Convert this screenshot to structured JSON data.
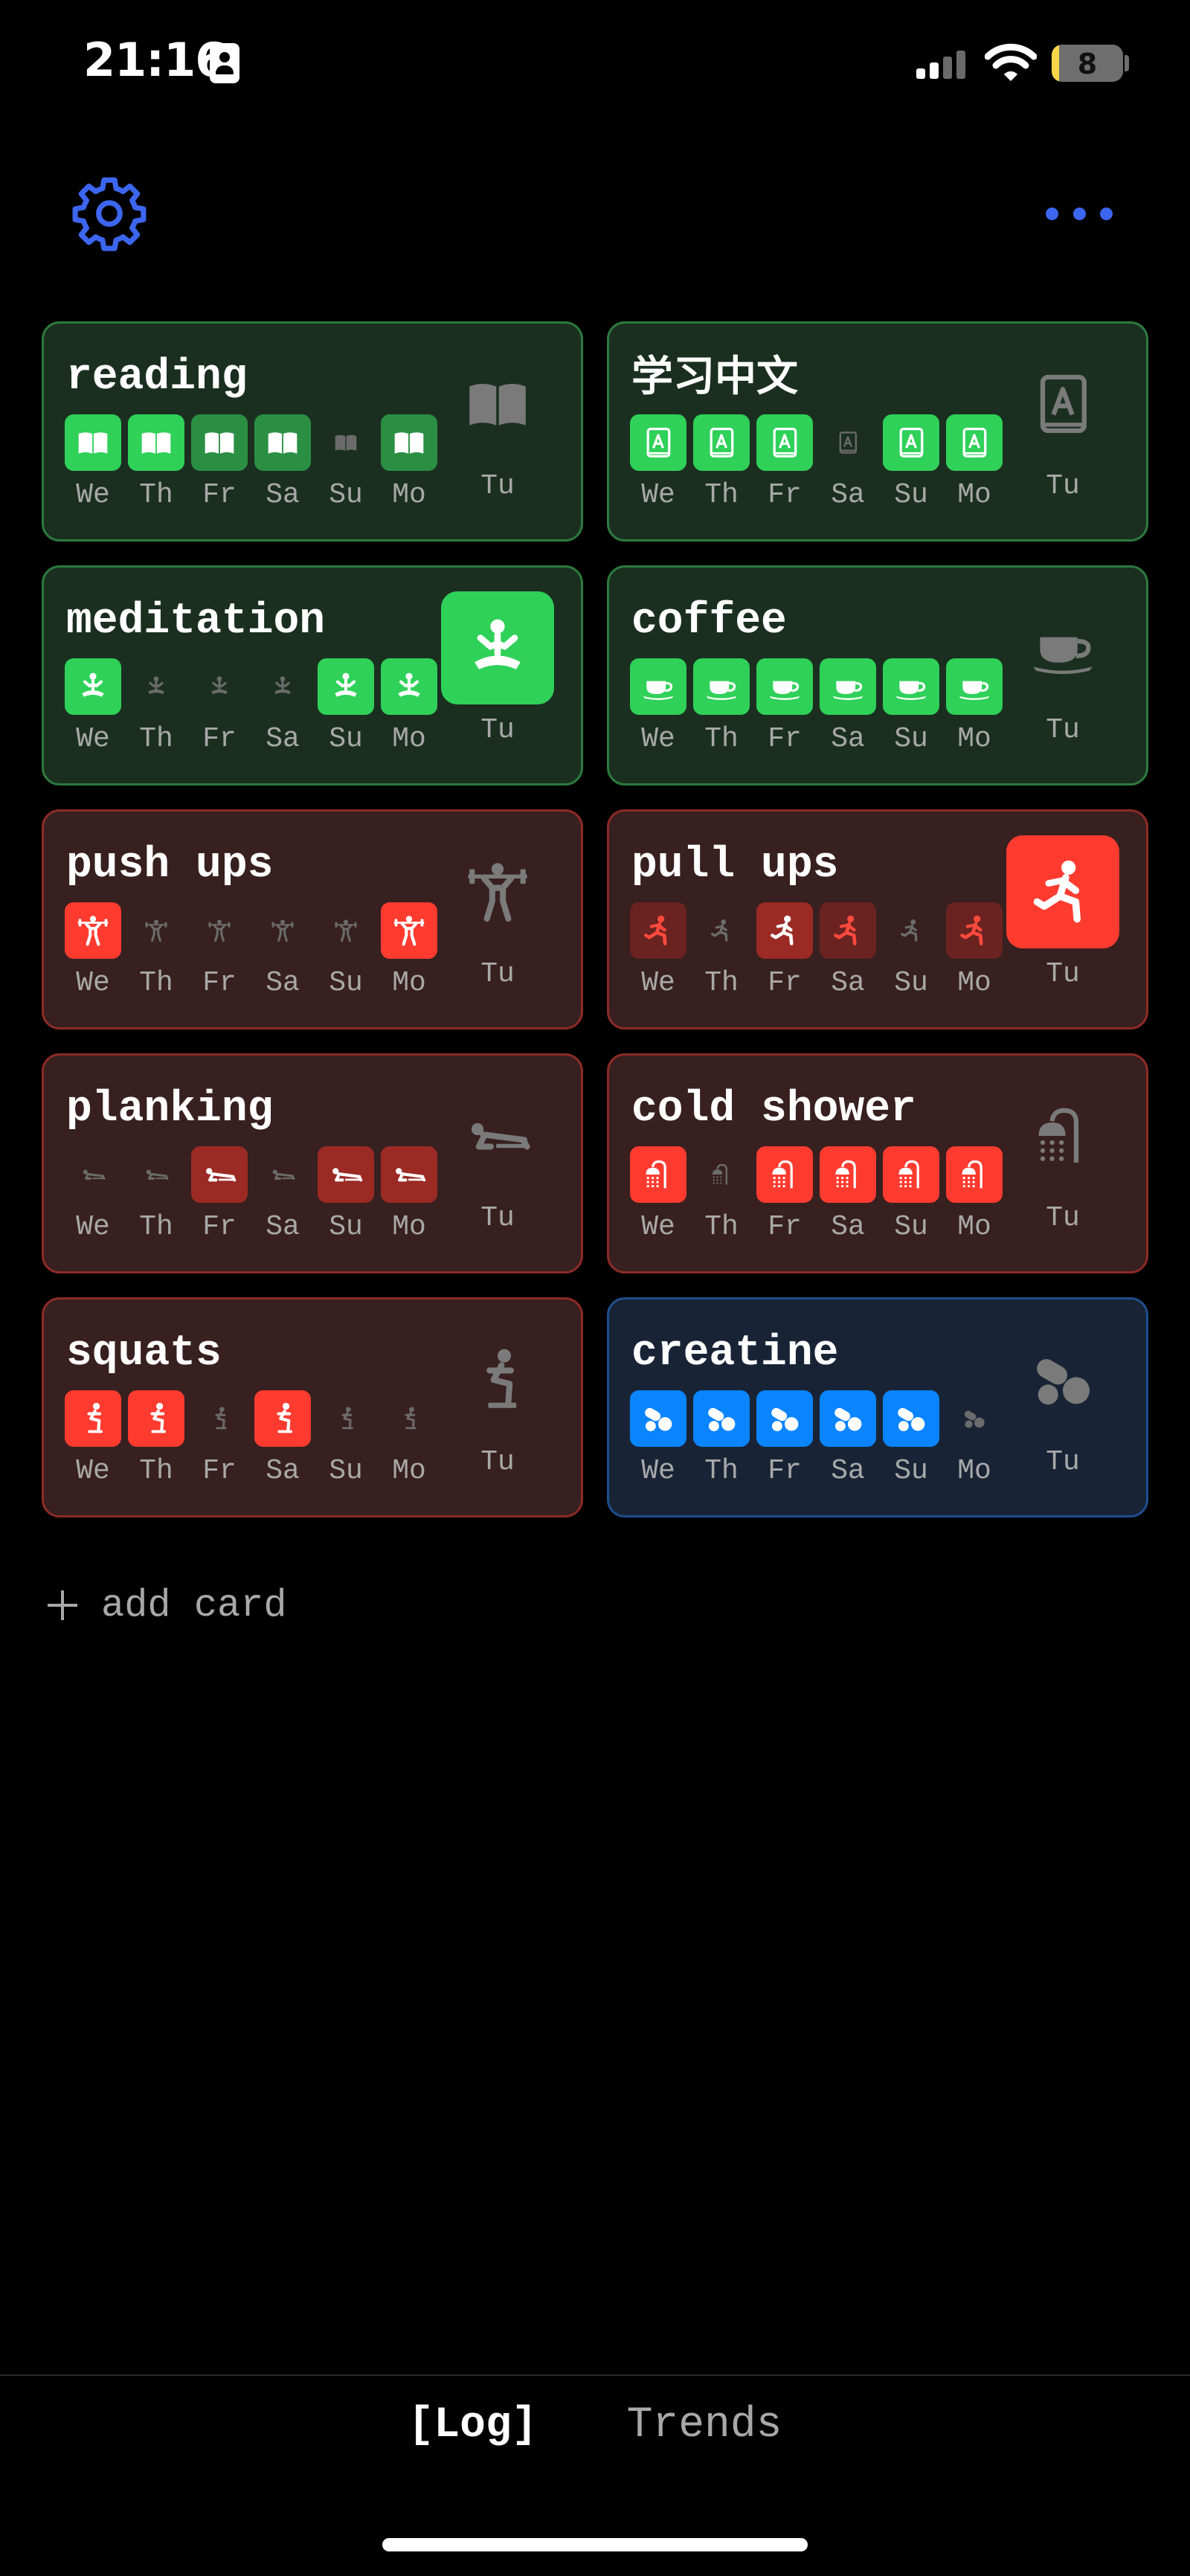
{
  "status_bar": {
    "time": "21:16",
    "battery": "8"
  },
  "colors": {
    "accent_blue": "#3d66f0",
    "green_done": "#2fd158",
    "red_done": "#ff3b30",
    "blue_done": "#0a84ff"
  },
  "cards": [
    {
      "title": "reading",
      "icon": "book-icon",
      "theme": "green",
      "days": [
        {
          "label": "We",
          "state": "bright"
        },
        {
          "label": "Th",
          "state": "bright"
        },
        {
          "label": "Fr",
          "state": "dark"
        },
        {
          "label": "Sa",
          "state": "dark"
        },
        {
          "label": "Su",
          "state": "off"
        },
        {
          "label": "Mo",
          "state": "dark"
        }
      ],
      "today": {
        "label": "Tu",
        "state": "off"
      }
    },
    {
      "title": "学习中文",
      "icon": "dictionary-icon",
      "theme": "green",
      "days": [
        {
          "label": "We",
          "state": "bright"
        },
        {
          "label": "Th",
          "state": "bright"
        },
        {
          "label": "Fr",
          "state": "bright"
        },
        {
          "label": "Sa",
          "state": "off"
        },
        {
          "label": "Su",
          "state": "bright"
        },
        {
          "label": "Mo",
          "state": "bright"
        }
      ],
      "today": {
        "label": "Tu",
        "state": "off"
      }
    },
    {
      "title": "meditation",
      "icon": "meditation-icon",
      "theme": "green",
      "days": [
        {
          "label": "We",
          "state": "bright"
        },
        {
          "label": "Th",
          "state": "off"
        },
        {
          "label": "Fr",
          "state": "off"
        },
        {
          "label": "Sa",
          "state": "off"
        },
        {
          "label": "Su",
          "state": "bright"
        },
        {
          "label": "Mo",
          "state": "bright"
        }
      ],
      "today": {
        "label": "Tu",
        "state": "bright"
      }
    },
    {
      "title": "coffee",
      "icon": "coffee-cup-icon",
      "theme": "green",
      "days": [
        {
          "label": "We",
          "state": "bright"
        },
        {
          "label": "Th",
          "state": "bright"
        },
        {
          "label": "Fr",
          "state": "bright"
        },
        {
          "label": "Sa",
          "state": "bright"
        },
        {
          "label": "Su",
          "state": "bright"
        },
        {
          "label": "Mo",
          "state": "bright"
        }
      ],
      "today": {
        "label": "Tu",
        "state": "off"
      }
    },
    {
      "title": "push ups",
      "icon": "weightlifting-icon",
      "theme": "red",
      "days": [
        {
          "label": "We",
          "state": "bright"
        },
        {
          "label": "Th",
          "state": "off"
        },
        {
          "label": "Fr",
          "state": "off"
        },
        {
          "label": "Sa",
          "state": "off"
        },
        {
          "label": "Su",
          "state": "off"
        },
        {
          "label": "Mo",
          "state": "bright"
        }
      ],
      "today": {
        "label": "Tu",
        "state": "off"
      }
    },
    {
      "title": "pull ups",
      "icon": "lunge-icon",
      "theme": "red",
      "days": [
        {
          "label": "We",
          "state": "darker"
        },
        {
          "label": "Th",
          "state": "off"
        },
        {
          "label": "Fr",
          "state": "dark"
        },
        {
          "label": "Sa",
          "state": "darker"
        },
        {
          "label": "Su",
          "state": "off"
        },
        {
          "label": "Mo",
          "state": "darker"
        }
      ],
      "today": {
        "label": "Tu",
        "state": "bright"
      }
    },
    {
      "title": "planking",
      "icon": "plank-icon",
      "theme": "red",
      "days": [
        {
          "label": "We",
          "state": "off"
        },
        {
          "label": "Th",
          "state": "off"
        },
        {
          "label": "Fr",
          "state": "dark"
        },
        {
          "label": "Sa",
          "state": "off"
        },
        {
          "label": "Su",
          "state": "dark"
        },
        {
          "label": "Mo",
          "state": "dark"
        }
      ],
      "today": {
        "label": "Tu",
        "state": "off"
      }
    },
    {
      "title": "cold shower",
      "icon": "shower-icon",
      "theme": "red",
      "days": [
        {
          "label": "We",
          "state": "bright"
        },
        {
          "label": "Th",
          "state": "off"
        },
        {
          "label": "Fr",
          "state": "bright"
        },
        {
          "label": "Sa",
          "state": "bright"
        },
        {
          "label": "Su",
          "state": "bright"
        },
        {
          "label": "Mo",
          "state": "bright"
        }
      ],
      "today": {
        "label": "Tu",
        "state": "off"
      }
    },
    {
      "title": "squats",
      "icon": "squat-icon",
      "theme": "red",
      "days": [
        {
          "label": "We",
          "state": "bright"
        },
        {
          "label": "Th",
          "state": "bright"
        },
        {
          "label": "Fr",
          "state": "off"
        },
        {
          "label": "Sa",
          "state": "bright"
        },
        {
          "label": "Su",
          "state": "off"
        },
        {
          "label": "Mo",
          "state": "off"
        }
      ],
      "today": {
        "label": "Tu",
        "state": "off"
      }
    },
    {
      "title": "creatine",
      "icon": "pills-icon",
      "theme": "blue",
      "days": [
        {
          "label": "We",
          "state": "bright"
        },
        {
          "label": "Th",
          "state": "bright"
        },
        {
          "label": "Fr",
          "state": "bright"
        },
        {
          "label": "Sa",
          "state": "bright"
        },
        {
          "label": "Su",
          "state": "bright"
        },
        {
          "label": "Mo",
          "state": "off"
        }
      ],
      "today": {
        "label": "Tu",
        "state": "off"
      }
    }
  ],
  "add_card": {
    "label": "add card"
  },
  "bottom_tabs": [
    {
      "label": "[Log]",
      "active": true
    },
    {
      "label": "Trends",
      "active": false
    }
  ]
}
